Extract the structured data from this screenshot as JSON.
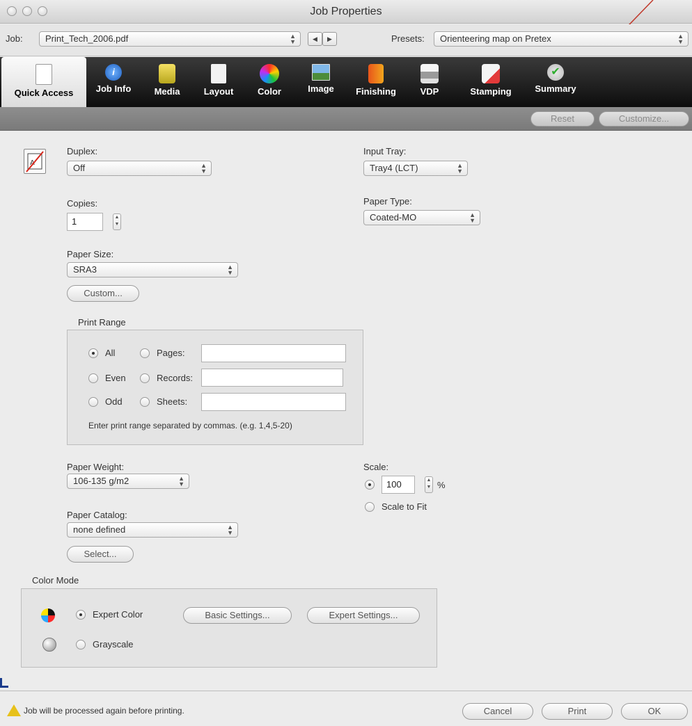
{
  "window": {
    "title": "Job Properties"
  },
  "job": {
    "label": "Job:",
    "file": "Print_Tech_2006.pdf",
    "presets_label": "Presets:",
    "preset_value": "Orienteering map on Pretex"
  },
  "toolbar": {
    "tabs": [
      {
        "label": "Quick Access",
        "icon": "quick-access-icon"
      },
      {
        "label": "Job Info",
        "icon": "info-icon"
      },
      {
        "label": "Media",
        "icon": "media-icon"
      },
      {
        "label": "Layout",
        "icon": "layout-icon"
      },
      {
        "label": "Color",
        "icon": "color-wheel-icon"
      },
      {
        "label": "Image",
        "icon": "image-icon"
      },
      {
        "label": "Finishing",
        "icon": "finishing-icon"
      },
      {
        "label": "VDP",
        "icon": "printer-icon"
      },
      {
        "label": "Stamping",
        "icon": "stamping-icon"
      },
      {
        "label": "Summary",
        "icon": "checkmark-icon"
      }
    ],
    "reset_label": "Reset",
    "customize_label": "Customize..."
  },
  "quick_access": {
    "duplex_label": "Duplex:",
    "duplex_value": "Off",
    "copies_label": "Copies:",
    "copies_value": "1",
    "paper_size_label": "Paper Size:",
    "paper_size_value": "SRA3",
    "custom_label": "Custom...",
    "input_tray_label": "Input Tray:",
    "input_tray_value": "Tray4 (LCT)",
    "paper_type_label": "Paper Type:",
    "paper_type_value": "Coated-MO",
    "print_range": {
      "title": "Print Range",
      "all": "All",
      "even": "Even",
      "odd": "Odd",
      "pages": "Pages:",
      "records": "Records:",
      "sheets": "Sheets:",
      "hint": "Enter print range separated by commas. (e.g. 1,4,5-20)"
    },
    "paper_weight_label": "Paper Weight:",
    "paper_weight_value": "106-135 g/m2",
    "paper_catalog_label": "Paper Catalog:",
    "paper_catalog_value": "none defined",
    "select_label": "Select...",
    "scale_label": "Scale:",
    "scale_value": "100",
    "scale_unit": "%",
    "scale_to_fit": "Scale to Fit",
    "color_mode": {
      "title": "Color Mode",
      "expert_color": "Expert Color",
      "grayscale": "Grayscale",
      "basic_settings": "Basic Settings...",
      "expert_settings": "Expert Settings..."
    }
  },
  "footer": {
    "warning": "Job will be processed again before printing.",
    "cancel": "Cancel",
    "print": "Print",
    "ok": "OK"
  },
  "colors": {
    "annotation_line": "#c0392b",
    "toolbar_bg": "#111111"
  }
}
